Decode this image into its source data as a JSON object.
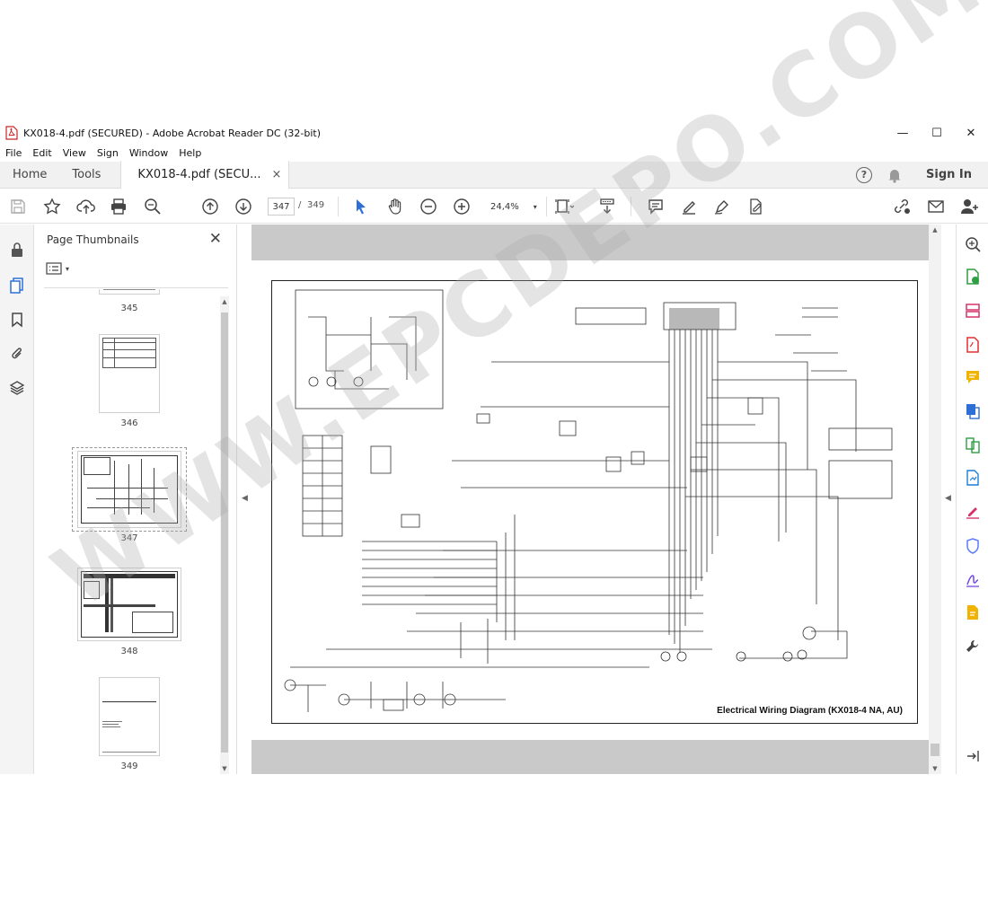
{
  "window": {
    "title": "KX018-4.pdf (SECURED) - Adobe Acrobat Reader DC (32-bit)",
    "controls": {
      "minimize": "—",
      "maximize": "☐",
      "close": "✕"
    }
  },
  "menu": {
    "items": [
      "File",
      "Edit",
      "View",
      "Sign",
      "Window",
      "Help"
    ]
  },
  "tabs": {
    "home": "Home",
    "tools": "Tools",
    "document": "KX018-4.pdf (SECU...",
    "document_close": "×",
    "help": "?",
    "sign_in": "Sign In"
  },
  "toolbar": {
    "current_page": "347",
    "separator": "/",
    "total_pages": "349",
    "zoom": "24,4%",
    "zoom_caret": "▾",
    "icons": [
      "save-icon",
      "bookmark-star-icon",
      "cloud-upload-icon",
      "print-icon",
      "zoom-search-icon",
      "page-up-icon",
      "page-down-icon",
      "select-cursor-icon",
      "hand-icon",
      "zoom-out-icon",
      "zoom-in-icon",
      "page-fit-icon",
      "scroll-mode-icon",
      "comment-icon",
      "highlight-pen-icon",
      "draw-icon",
      "fill-sign-icon",
      "share-link-icon",
      "email-icon",
      "add-user-icon"
    ]
  },
  "thumbnails_panel": {
    "title": "Page Thumbnails",
    "close": "✕",
    "pages": [
      "345",
      "346",
      "347",
      "348",
      "349"
    ],
    "selected_page": "347"
  },
  "document": {
    "caption": "Electrical Wiring Diagram (KX018-4 NA, AU)"
  },
  "watermark": "WWW.EPCDEPO.COM",
  "colors": {
    "accent_blue": "#2e6fd6",
    "pink": "#d6336c",
    "green": "#2f9e44",
    "purple": "#7048e8",
    "doc_gray": "#c9c9c9"
  }
}
